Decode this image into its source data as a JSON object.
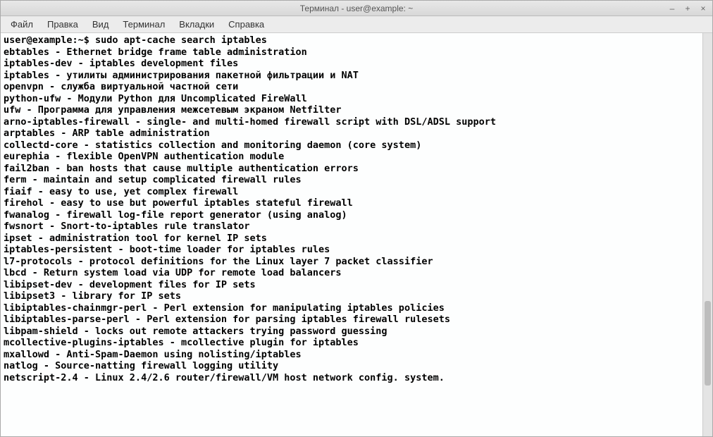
{
  "window": {
    "title": "Терминал - user@example: ~"
  },
  "menu": {
    "file": "Файл",
    "edit": "Правка",
    "view": "Вид",
    "terminal": "Терминал",
    "tabs": "Вкладки",
    "help": "Справка"
  },
  "controls": {
    "minimize": "–",
    "maximize": "+",
    "close": "×"
  },
  "prompt": {
    "user_host": "user@example:~$ ",
    "command": "sudo apt-cache search iptables"
  },
  "lines": [
    "ebtables - Ethernet bridge frame table administration",
    "iptables-dev - iptables development files",
    "iptables - утилиты администрирования пакетной фильтрации и NAT",
    "openvpn - служба виртуальной частной сети",
    "python-ufw - Модули Python для Uncomplicated FireWall",
    "ufw - Программа для управления межсетевым экраном Netfilter",
    "arno-iptables-firewall - single- and multi-homed firewall script with DSL/ADSL support",
    "arptables - ARP table administration",
    "collectd-core - statistics collection and monitoring daemon (core system)",
    "eurephia - flexible OpenVPN authentication module",
    "fail2ban - ban hosts that cause multiple authentication errors",
    "ferm - maintain and setup complicated firewall rules",
    "fiaif - easy to use, yet complex firewall",
    "firehol - easy to use but powerful iptables stateful firewall",
    "fwanalog - firewall log-file report generator (using analog)",
    "fwsnort - Snort-to-iptables rule translator",
    "ipset - administration tool for kernel IP sets",
    "iptables-persistent - boot-time loader for iptables rules",
    "l7-protocols - protocol definitions for the Linux layer 7 packet classifier",
    "lbcd - Return system load via UDP for remote load balancers",
    "libipset-dev - development files for IP sets",
    "libipset3 - library for IP sets",
    "libiptables-chainmgr-perl - Perl extension for manipulating iptables policies",
    "libiptables-parse-perl - Perl extension for parsing iptables firewall rulesets",
    "libpam-shield - locks out remote attackers trying password guessing",
    "mcollective-plugins-iptables - mcollective plugin for iptables",
    "mxallowd - Anti-Spam-Daemon using nolisting/iptables",
    "natlog - Source-natting firewall logging utility",
    "netscript-2.4 - Linux 2.4/2.6 router/firewall/VM host network config. system."
  ]
}
